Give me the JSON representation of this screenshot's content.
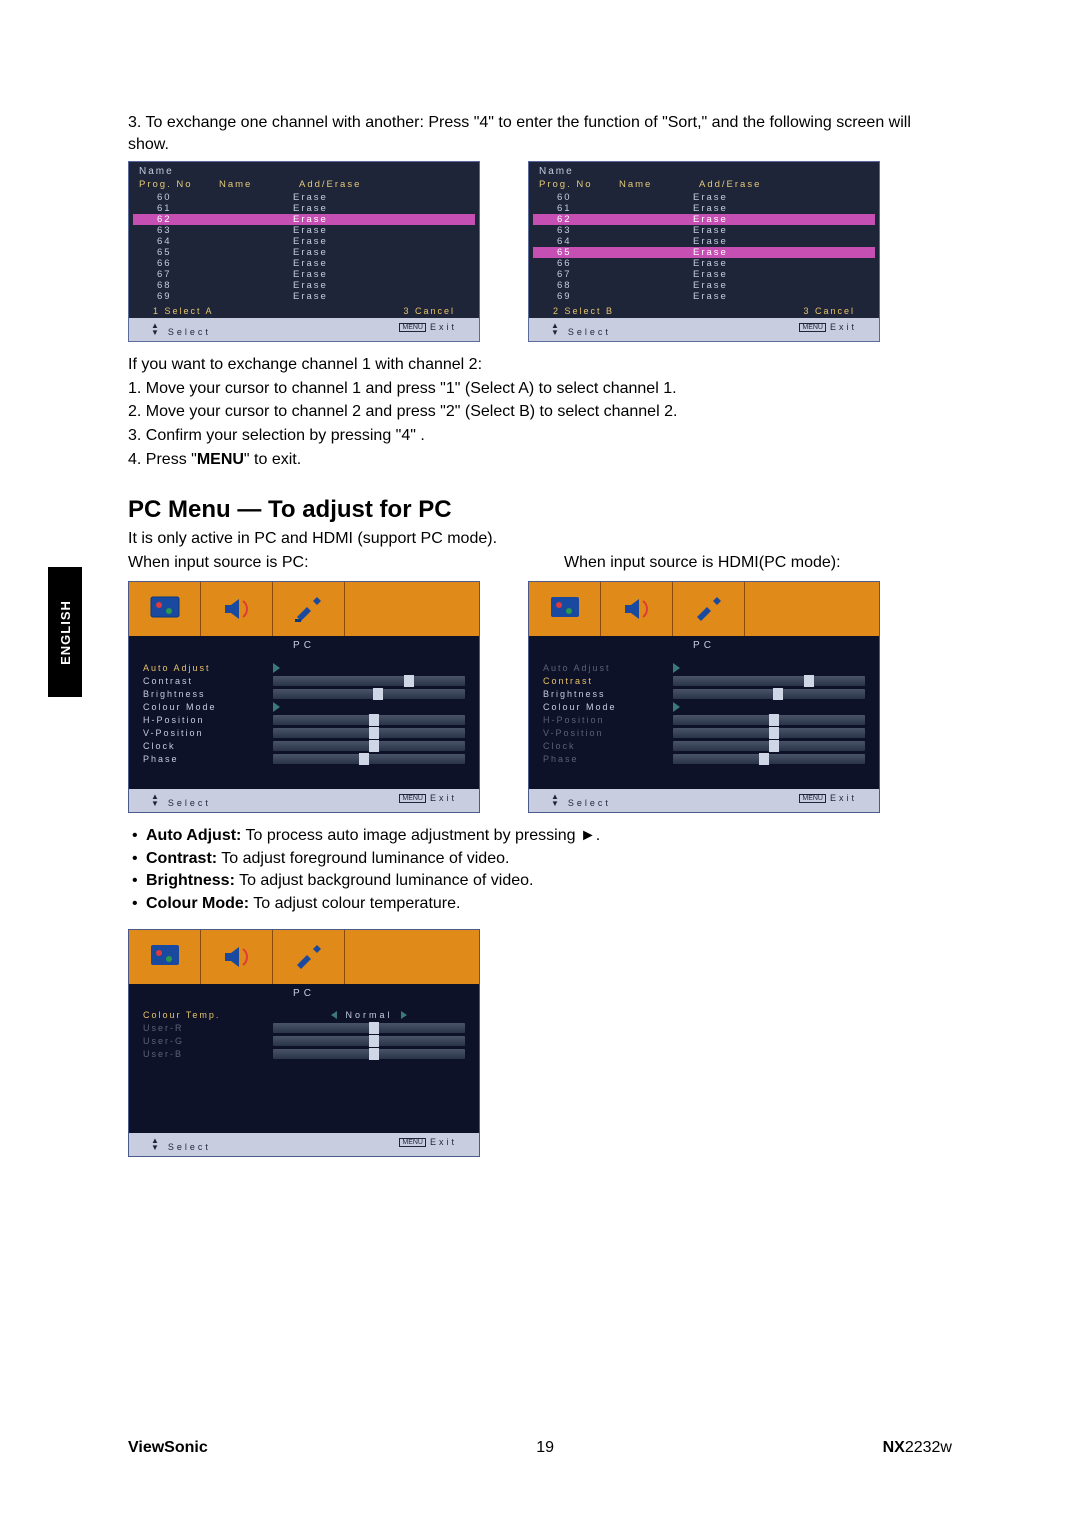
{
  "intro": "3. To exchange one channel with another: Press \"4\" to enter the function of \"Sort,\" and the following screen will show.",
  "sort": {
    "title": "Name",
    "headers": {
      "prog": "Prog. No",
      "name": "Name",
      "act": "Add/Erase"
    },
    "rows": [
      {
        "no": "60",
        "act": "Erase"
      },
      {
        "no": "61",
        "act": "Erase"
      },
      {
        "no": "62",
        "act": "Erase"
      },
      {
        "no": "63",
        "act": "Erase"
      },
      {
        "no": "64",
        "act": "Erase"
      },
      {
        "no": "65",
        "act": "Erase"
      },
      {
        "no": "66",
        "act": "Erase"
      },
      {
        "no": "67",
        "act": "Erase"
      },
      {
        "no": "68",
        "act": "Erase"
      },
      {
        "no": "69",
        "act": "Erase"
      }
    ],
    "footA": {
      "left": "1 Select A",
      "right": "3 Cancel"
    },
    "footB": {
      "left": "2 Select B",
      "right": "3 Cancel"
    },
    "bar": {
      "select": "Select",
      "menu": "MENU",
      "exit": "Exit"
    }
  },
  "exchange": {
    "lead": "If you want to exchange channel 1 with channel 2:",
    "s1": "1. Move your cursor to channel 1 and press \"1\" (Select A) to select channel 1.",
    "s2": "2. Move your cursor to channel 2 and press \"2\" (Select B) to select channel 2.",
    "s3": "3. Confirm your selection by pressing \"4\" .",
    "s4a": "4. Press \"",
    "s4b": "MENU",
    "s4c": "\" to exit."
  },
  "pcmenu": {
    "heading": "PC Menu — To adjust for PC",
    "sub": "It is only active in PC and HDMI (support PC mode).",
    "left_label": "When input source is PC:",
    "right_label": "When input source is HDMI(PC mode):",
    "osd_label": "PC",
    "items": {
      "auto": "Auto Adjust",
      "contrast": "Contrast",
      "brightness": "Brightness",
      "colour": "Colour Mode",
      "hpos": "H-Position",
      "vpos": "V-Position",
      "clock": "Clock",
      "phase": "Phase"
    },
    "sliders": {
      "contrast": 68,
      "brightness": 52,
      "hpos": 50,
      "vpos": 50,
      "clock": 50,
      "phase": 45
    }
  },
  "bullets": {
    "auto_b": "Auto Adjust:",
    "auto_t": " To process auto image adjustment by pressing ►.",
    "con_b": "Contrast:",
    "con_t": " To adjust foreground luminance of video.",
    "bri_b": "Brightness:",
    "bri_t": " To adjust background luminance of video.",
    "col_b": "Colour Mode:",
    "col_t": " To adjust colour temperature."
  },
  "colour_osd": {
    "items": {
      "ctemp": "Colour Temp.",
      "ur": "User-R",
      "ug": "User-G",
      "ub": "User-B"
    },
    "value": "Normal",
    "sliders": {
      "r": 50,
      "g": 50,
      "b": 50
    }
  },
  "footer": {
    "brand": "ViewSonic",
    "page": "19",
    "model_pre": "NX",
    "model_suf": "2232w"
  },
  "tab": "ENGLISH"
}
